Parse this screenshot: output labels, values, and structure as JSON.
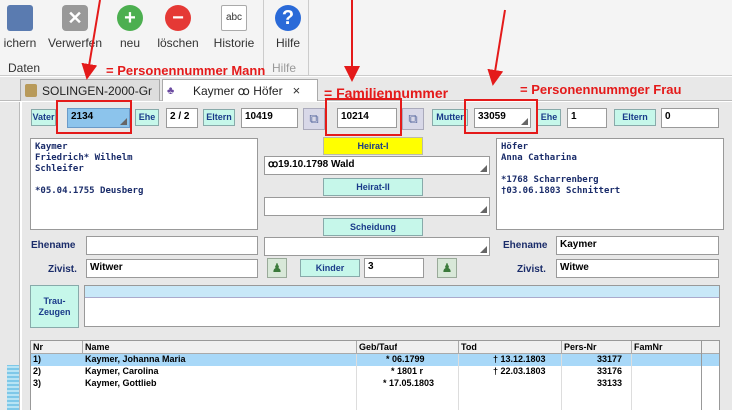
{
  "toolbar": {
    "buttons": [
      {
        "label": "ichern",
        "icon": "save-icon"
      },
      {
        "label": "Verwerfen",
        "icon": "discard-icon"
      },
      {
        "label": "neu",
        "icon": "add-icon"
      },
      {
        "label": "löschen",
        "icon": "delete-icon"
      },
      {
        "label": "Historie",
        "icon": "history-icon",
        "icon_text": "abc"
      },
      {
        "label": "Hilfe",
        "icon": "help-icon",
        "icon_text": "?"
      }
    ],
    "group_daten": "Daten",
    "group_hilfe": "Hilfe"
  },
  "tabs": [
    {
      "label": "SOLINGEN-2000-Gr"
    },
    {
      "label": "Kaymer ꝏ Höfer",
      "close": "×"
    }
  ],
  "annotations": {
    "person_man": "= Personennummer Mann",
    "family": "= Familiennummer",
    "person_woman": "= Personennummger Frau"
  },
  "form": {
    "vater_btn": "Vater",
    "vater_nr": "2134",
    "ehe_btn_left": "Ehe",
    "ehe_left_value": "2 / 2",
    "eltern_btn_left": "Eltern",
    "eltern_left_value": "10419",
    "family_nr": "10214",
    "mutter_btn": "Mutter",
    "mutter_nr": "33059",
    "ehe_btn_right": "Ehe",
    "ehe_right_value": "1",
    "eltern_btn_right": "Eltern",
    "eltern_right_value": "0",
    "heirat1_btn": "Heirat-I",
    "heirat1_value": "ꝏ19.10.1798 Wald",
    "heirat2_btn": "Heirat-II",
    "heirat2_value": "",
    "scheidung_btn": "Scheidung",
    "scheidung_value": "",
    "kinder_btn": "Kinder",
    "kinder_value": "3",
    "man_info": "Kaymer\nFriedrich* Wilhelm\nSchleifer\n\n*05.04.1755 Deusberg",
    "woman_info": "Höfer\nAnna Catharina\n\n*1768 Scharrenberg\n†03.06.1803 Schnittert",
    "ehename_label_left": "Ehename",
    "ehename_left": "",
    "zivist_label_left": "Zivist.",
    "zivist_left": "Witwer",
    "ehename_label_right": "Ehename",
    "ehename_right": "Kaymer",
    "zivist_label_right": "Zivist.",
    "zivist_right": "Witwe",
    "trauzeugen_btn": "Trau-\nZeugen"
  },
  "children_table": {
    "headers": [
      "Nr",
      "Name",
      "Geb/Tauf",
      "Tod",
      "Pers-Nr",
      "FamNr"
    ],
    "rows": [
      {
        "nr": "1)",
        "name": "Kaymer, Johanna Maria",
        "geb": "*     06.1799",
        "tod": "† 13.12.1803",
        "pers": "33177",
        "fam": "",
        "selected": true
      },
      {
        "nr": "2)",
        "name": "Kaymer, Carolina",
        "geb": "*        1801 r",
        "tod": "† 22.03.1803",
        "pers": "33176",
        "fam": "",
        "selected": false
      },
      {
        "nr": "3)",
        "name": "Kaymer, Gottlieb",
        "geb": "* 17.05.1803",
        "tod": "",
        "pers": "33133",
        "fam": "",
        "selected": false
      }
    ]
  },
  "colors": {
    "accent_button": "#c6f7ea",
    "heirat_button": "#ffff00",
    "selected_row": "#a8d8f8",
    "annotation_red": "#e41a1a"
  }
}
